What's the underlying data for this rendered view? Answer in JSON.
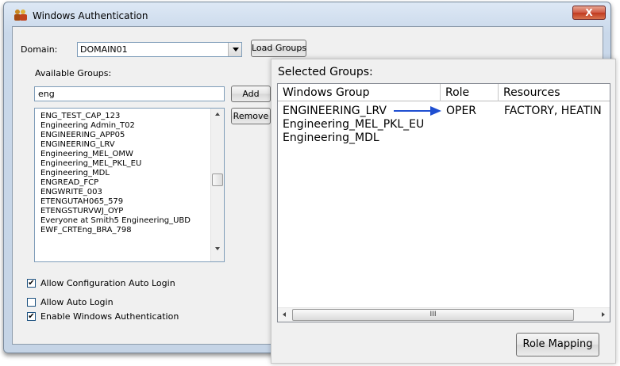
{
  "window": {
    "title": "Windows Authentication",
    "close_label": "X"
  },
  "domain": {
    "label": "Domain:",
    "value": "DOMAIN01",
    "load_button": "Load Groups"
  },
  "available": {
    "label": "Available Groups:",
    "filter_value": "eng",
    "add_button": "Add",
    "remove_button": "Remove",
    "items": [
      "ENG_TEST_CAP_123",
      "Engineering Admin_T02",
      "ENGINEERING_APP05",
      "ENGINEERING_LRV",
      "Engineering_MEL_OMW",
      "Engineering_MEL_PKL_EU",
      "Engineering_MDL",
      "ENGREAD_FCP",
      "ENGWRITE_003",
      "ETENGUTAH065_579",
      "ETENGSTURVWJ_OYP",
      "Everyone at Smith5 Engineering_UBD",
      "EWF_CRTEng_BRA_798"
    ]
  },
  "options": {
    "allow_config_auto_login": {
      "label": "Allow Configuration Auto Login",
      "checked": true
    },
    "allow_auto_login": {
      "label": "Allow Auto Login",
      "checked": false
    },
    "enable_windows_auth": {
      "label": "Enable Windows Authentication",
      "checked": true
    }
  },
  "selected": {
    "title": "Selected Groups:",
    "columns": [
      "Windows Group",
      "Role",
      "Resources"
    ],
    "rows": [
      {
        "group": "ENGINEERING_LRV",
        "role": "OPER",
        "resources": "FACTORY, HEATIN"
      },
      {
        "group": "Engineering_MEL_PKL_EU",
        "role": "",
        "resources": ""
      },
      {
        "group": "Engineering_MDL",
        "role": "",
        "resources": ""
      }
    ],
    "scroll_grip": "III",
    "role_mapping_button": "Role Mapping"
  },
  "colors": {
    "arrow": "#1f4fd1",
    "window_frame": "#c9d8ea",
    "close_button": "#c0391f"
  },
  "icons": {
    "app": "people-group-icon",
    "check": "✔"
  }
}
